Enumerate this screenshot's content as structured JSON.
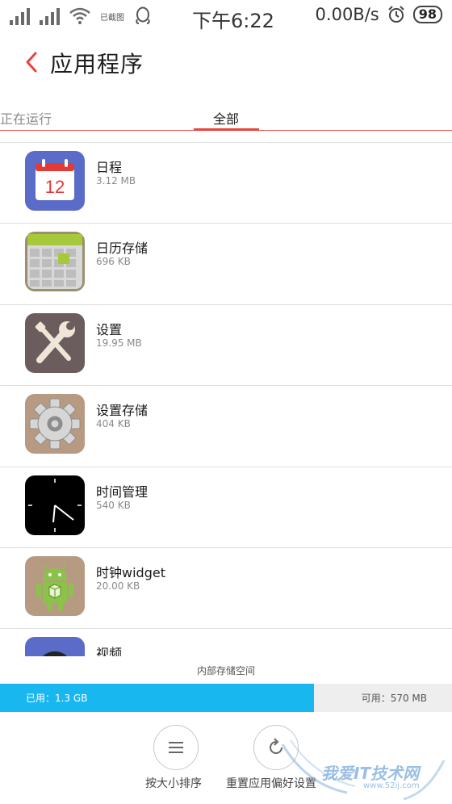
{
  "status_bar": {
    "carrier_note": "已截图",
    "time": "下午6:22",
    "speed": "0.00B/s",
    "battery": "98"
  },
  "header": {
    "title": "应用程序"
  },
  "tabs": [
    {
      "label": "正在运行",
      "active": false
    },
    {
      "label": "全部",
      "active": true
    }
  ],
  "apps": [
    {
      "name": "日程",
      "size": "3.12 MB",
      "icon": "calendar-icon",
      "icon_text": "12"
    },
    {
      "name": "日历存储",
      "size": "696 KB",
      "icon": "calendar-storage-icon"
    },
    {
      "name": "设置",
      "size": "19.95 MB",
      "icon": "settings-tools-icon"
    },
    {
      "name": "设置存储",
      "size": "404 KB",
      "icon": "gear-storage-icon"
    },
    {
      "name": "时间管理",
      "size": "540 KB",
      "icon": "clock-icon"
    },
    {
      "name": "时钟widget",
      "size": "20.00 KB",
      "icon": "android-icon"
    },
    {
      "name": "视频",
      "size": "",
      "icon": "video-icon"
    }
  ],
  "storage": {
    "label": "内部存储空间",
    "used_text": "已用：1.3 GB",
    "free_text": "可用：570 MB",
    "used_fraction": 0.695,
    "used_color": "#19b7ef"
  },
  "actions": {
    "sort_label": "按大小排序",
    "reset_label": "重置应用偏好设置"
  },
  "watermark": {
    "text": "我爱IT技术网",
    "sub": "www.52ij.com"
  },
  "colors": {
    "accent": "#e8433c"
  }
}
